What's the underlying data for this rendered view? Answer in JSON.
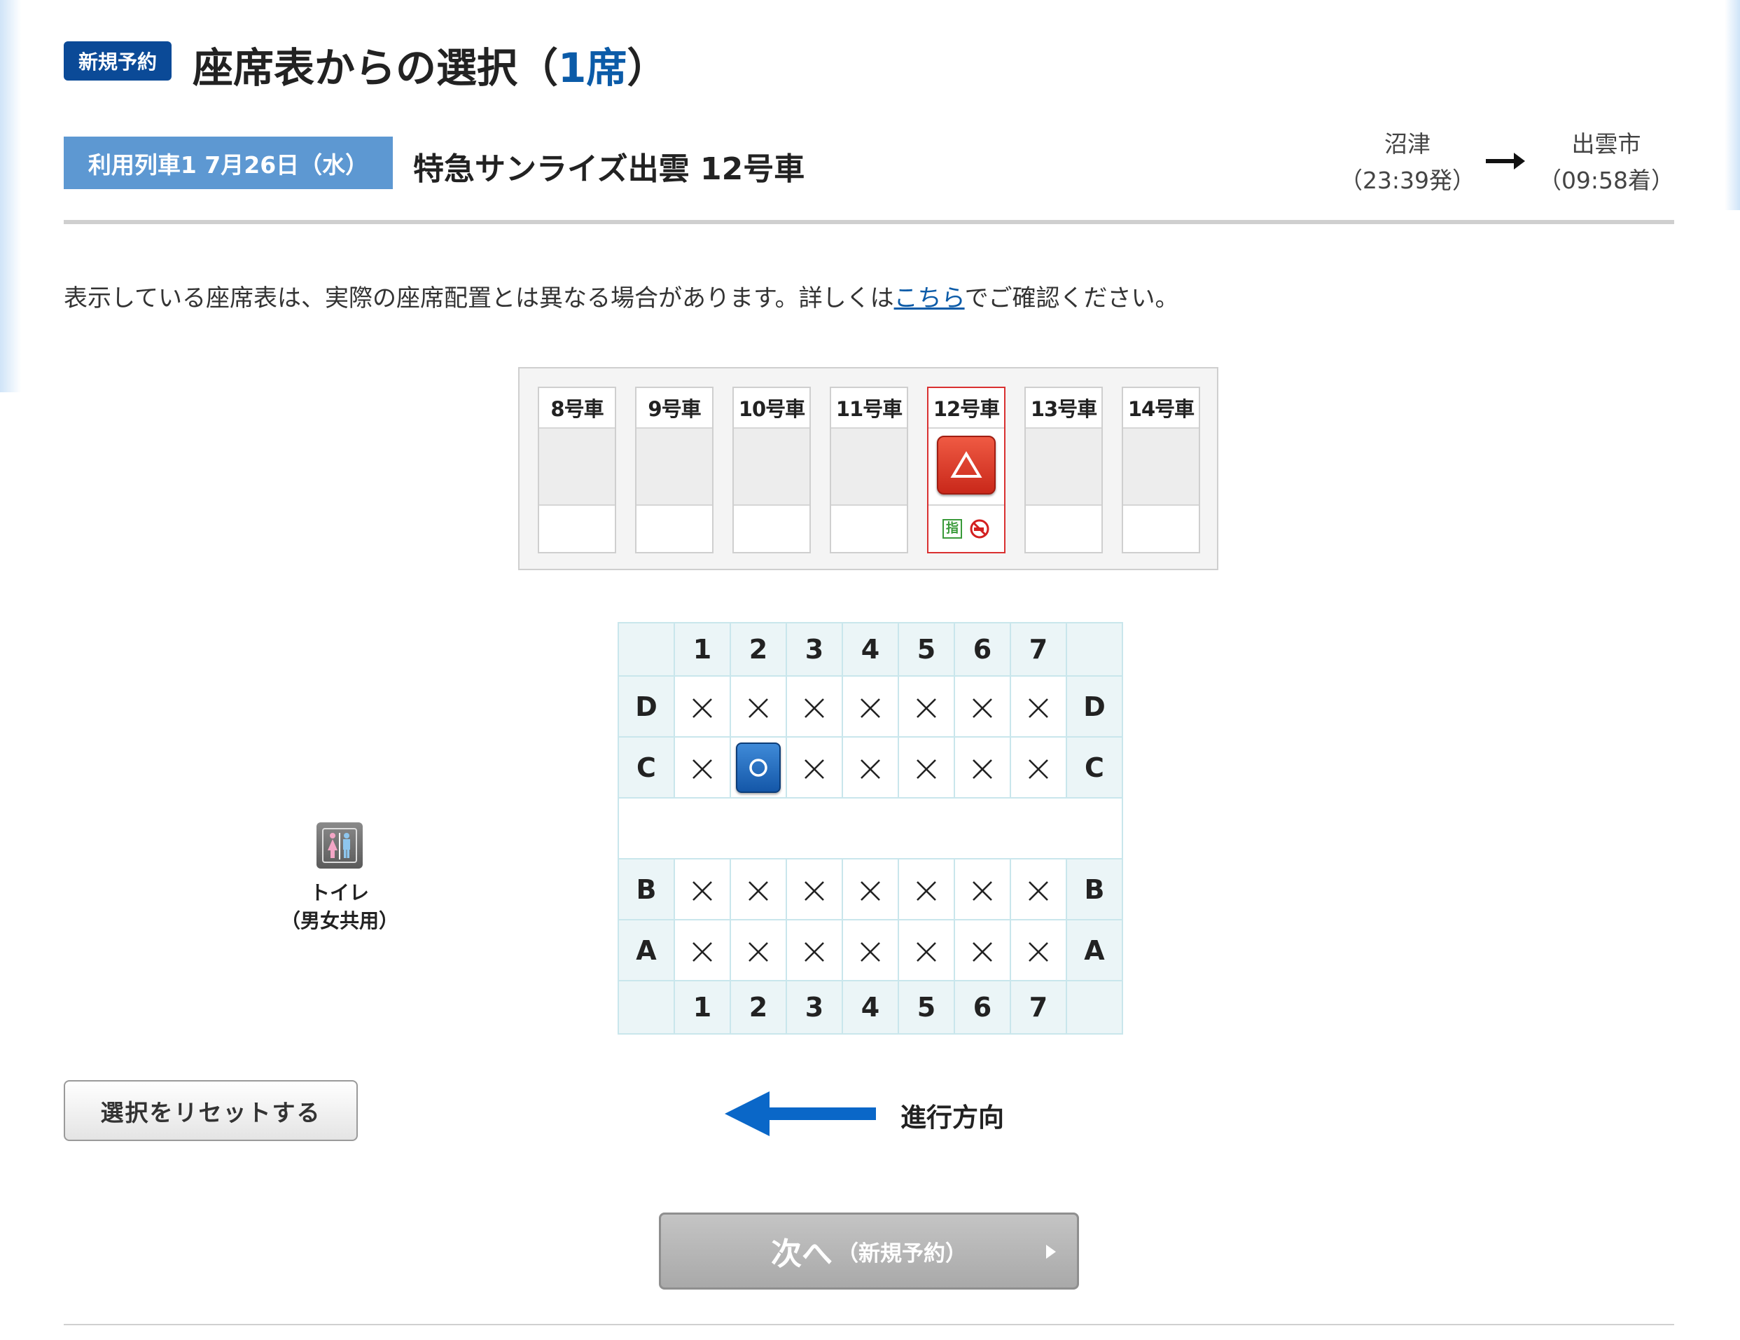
{
  "header": {
    "badge": "新規予約",
    "title": "座席表からの選択（",
    "title_count": "1席",
    "title_close": "）"
  },
  "train": {
    "badge": "利用列車1  7月26日（水）",
    "name": "特急サンライズ出雲  12号車",
    "from_station": "沼津",
    "from_time": "（23:39発）",
    "to_station": "出雲市",
    "to_time": "（09:58着）"
  },
  "notice": {
    "before": "表示している座席表は、実際の座席配置とは異なる場合があります。詳しくは",
    "link": "こちら",
    "after": "でご確認ください。"
  },
  "cars": [
    {
      "label": "8号車",
      "selected": false,
      "available": false
    },
    {
      "label": "9号車",
      "selected": false,
      "available": false
    },
    {
      "label": "10号車",
      "selected": false,
      "available": false
    },
    {
      "label": "11号車",
      "selected": false,
      "available": false
    },
    {
      "label": "12号車",
      "selected": true,
      "available": true,
      "availability_symbol": "△",
      "reserved_icon": "指"
    },
    {
      "label": "13号車",
      "selected": false,
      "available": false
    },
    {
      "label": "14号車",
      "selected": false,
      "available": false
    }
  ],
  "seat_map": {
    "columns": [
      "1",
      "2",
      "3",
      "4",
      "5",
      "6",
      "7"
    ],
    "rows": [
      {
        "label": "D",
        "seats": [
          "×",
          "×",
          "×",
          "×",
          "×",
          "×",
          "×"
        ]
      },
      {
        "label": "C",
        "seats": [
          "×",
          "○",
          "×",
          "×",
          "×",
          "×",
          "×"
        ]
      },
      {
        "aisle": true
      },
      {
        "label": "B",
        "seats": [
          "×",
          "×",
          "×",
          "×",
          "×",
          "×",
          "×"
        ]
      },
      {
        "label": "A",
        "seats": [
          "×",
          "×",
          "×",
          "×",
          "×",
          "×",
          "×"
        ]
      }
    ],
    "selected_seat": "2C"
  },
  "toilet": {
    "icon": "restroom-icon",
    "label_line1": "トイレ",
    "label_line2": "（男女共用）"
  },
  "reset_button": "選択をリセットする",
  "direction_label": "進行方向",
  "next_button": {
    "label": "次へ",
    "sub_label": "（新規予約）"
  },
  "colors": {
    "badge_dark": "#0b4a97",
    "badge_light": "#5d98d2",
    "available_red": "#d93030",
    "selected_seat_blue": "#1f6bc1",
    "direction_arrow": "#0a67c8"
  }
}
